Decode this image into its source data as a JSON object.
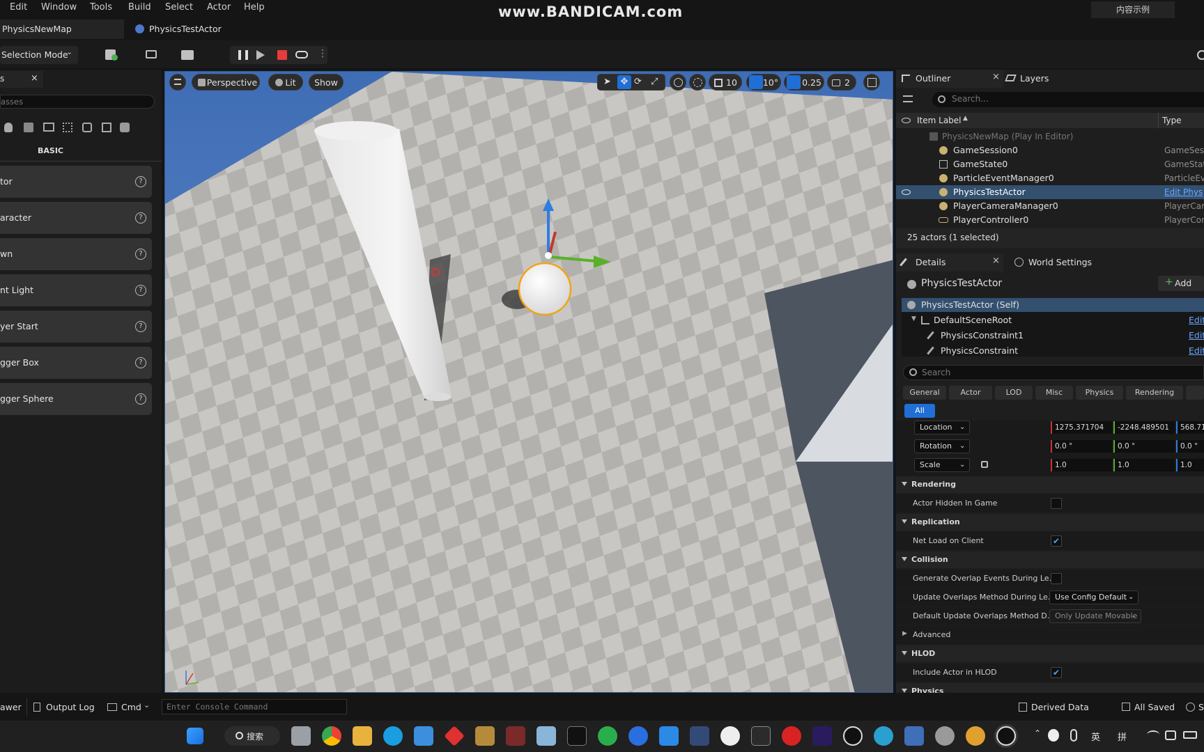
{
  "menu": {
    "items": [
      "Edit",
      "Window",
      "Tools",
      "Build",
      "Select",
      "Actor",
      "Help"
    ]
  },
  "watermark": "www.BANDICAM.com",
  "top_right_button": "内容示例",
  "tabs": {
    "map": "PhysicsNewMap",
    "actor": "PhysicsTestActor"
  },
  "toolbar": {
    "mode": "Selection Mode"
  },
  "place_actors": {
    "tab_label": "s",
    "search_placeholder": "asses",
    "category": "BASIC",
    "items": [
      {
        "label": "tor"
      },
      {
        "label": "aracter"
      },
      {
        "label": "wn"
      },
      {
        "label": "nt Light"
      },
      {
        "label": "yer Start"
      },
      {
        "label": "gger Box"
      },
      {
        "label": "gger Sphere"
      }
    ]
  },
  "viewport": {
    "perspective": "Perspective",
    "lit": "Lit",
    "show": "Show",
    "grid_snap": "10",
    "rotation_snap": "10°",
    "scale_snap": "0.25",
    "camera_speed": "2"
  },
  "outliner": {
    "tab": "Outliner",
    "layers_tab": "Layers",
    "search_placeholder": "Search...",
    "col_label": "Item Label",
    "col_type": "Type",
    "world": "PhysicsNewMap (Play In Editor)",
    "rows": [
      {
        "label": "GameSession0",
        "type": "GameSes"
      },
      {
        "label": "GameState0",
        "type": "GameStat"
      },
      {
        "label": "ParticleEventManager0",
        "type": "ParticleEv"
      },
      {
        "label": "PhysicsTestActor",
        "type": "Edit Phys"
      },
      {
        "label": "PlayerCameraManager0",
        "type": "PlayerCar"
      },
      {
        "label": "PlayerController0",
        "type": "PlayerCor"
      }
    ],
    "status": "25 actors (1 selected)"
  },
  "details": {
    "tab": "Details",
    "world_settings_tab": "World Settings",
    "actor_name": "PhysicsTestActor",
    "add_label": "Add",
    "components": [
      {
        "label": "PhysicsTestActor (Self)",
        "edit": ""
      },
      {
        "label": "DefaultSceneRoot",
        "edit": "Edit"
      },
      {
        "label": "PhysicsConstraint1",
        "edit": "Edit"
      },
      {
        "label": "PhysicsConstraint",
        "edit": "Edit"
      }
    ],
    "search_placeholder": "Search",
    "filters": [
      "General",
      "Actor",
      "LOD",
      "Misc",
      "Physics",
      "Rendering"
    ],
    "filter_all": "All",
    "transform": {
      "location_label": "Location",
      "location": [
        "1275.371704",
        "-2248.489501",
        "568.71"
      ],
      "rotation_label": "Rotation",
      "rotation": [
        "0.0 °",
        "0.0 °",
        "0.0 °"
      ],
      "scale_label": "Scale",
      "scale": [
        "1.0",
        "1.0",
        "1.0"
      ]
    },
    "sections": {
      "rendering": "Rendering",
      "actor_hidden": "Actor Hidden In Game",
      "replication": "Replication",
      "net_load": "Net Load on Client",
      "collision": "Collision",
      "gen_overlap": "Generate Overlap Events During Le...",
      "update_overlap": "Update Overlaps Method During Le...",
      "update_overlap_value": "Use Config Default",
      "default_update": "Default Update Overlaps Method D...",
      "default_update_value": "Only Update Movable",
      "advanced": "Advanced",
      "hlod": "HLOD",
      "include_hlod": "Include Actor in HLOD",
      "physics": "Physics"
    }
  },
  "statusbar": {
    "drawer": "awer",
    "output_log": "Output Log",
    "cmd": "Cmd",
    "console_placeholder": "Enter Console Command",
    "derived_data": "Derived Data",
    "all_saved": "All Saved",
    "source": "S"
  },
  "taskbar": {
    "search": "搜索",
    "ime1": "英",
    "ime2": "拼"
  }
}
